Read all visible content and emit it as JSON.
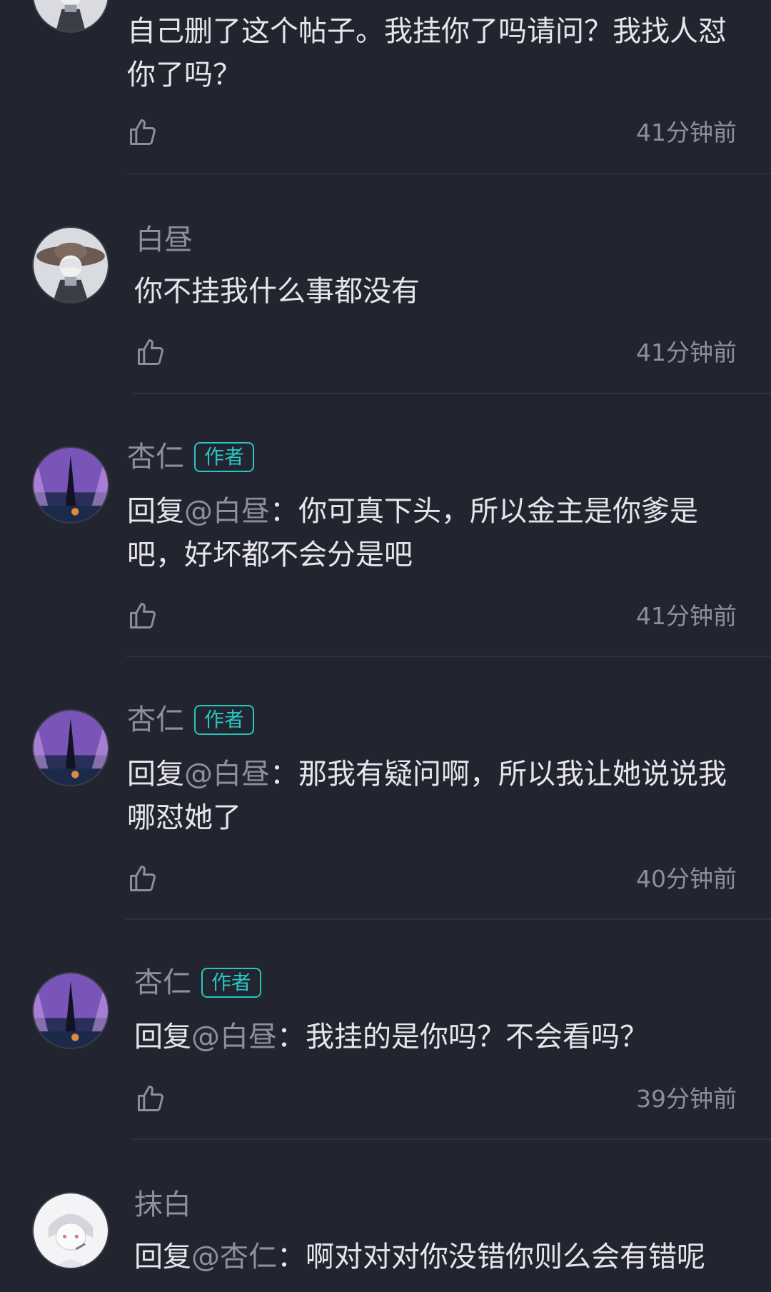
{
  "comments": [
    {
      "text": "自己删了这个帖子。我挂你了吗请问？我找人怼你了吗？",
      "time": "41分钟前"
    },
    {
      "name": "白昼",
      "text": "你不挂我什么事都没有",
      "time": "41分钟前"
    },
    {
      "name": "杏仁",
      "badge": "作者",
      "reply_prefix": "回复",
      "mention": "@白昼",
      "text": "：你可真下头，所以金主是你爹是吧，好坏都不会分是吧",
      "time": "41分钟前"
    },
    {
      "name": "杏仁",
      "badge": "作者",
      "reply_prefix": "回复",
      "mention": "@白昼",
      "text": "：那我有疑问啊，所以我让她说说我哪怼她了",
      "time": "40分钟前"
    },
    {
      "name": "杏仁",
      "badge": "作者",
      "reply_prefix": "回复",
      "mention": "@白昼",
      "text": "：我挂的是你吗？不会看吗？",
      "time": "39分钟前"
    },
    {
      "name": "抹白",
      "reply_prefix": "回复",
      "mention": "@杏仁",
      "text": "：啊对对对你没错你则么会有错呢"
    }
  ],
  "icons": {
    "like": "thumbs-up-outline-icon"
  },
  "colors": {
    "background": "#22242f",
    "text": "#e6e6ea",
    "muted": "#8d8f99",
    "author_badge": "#28c6c2",
    "divider": "#2f313d"
  }
}
